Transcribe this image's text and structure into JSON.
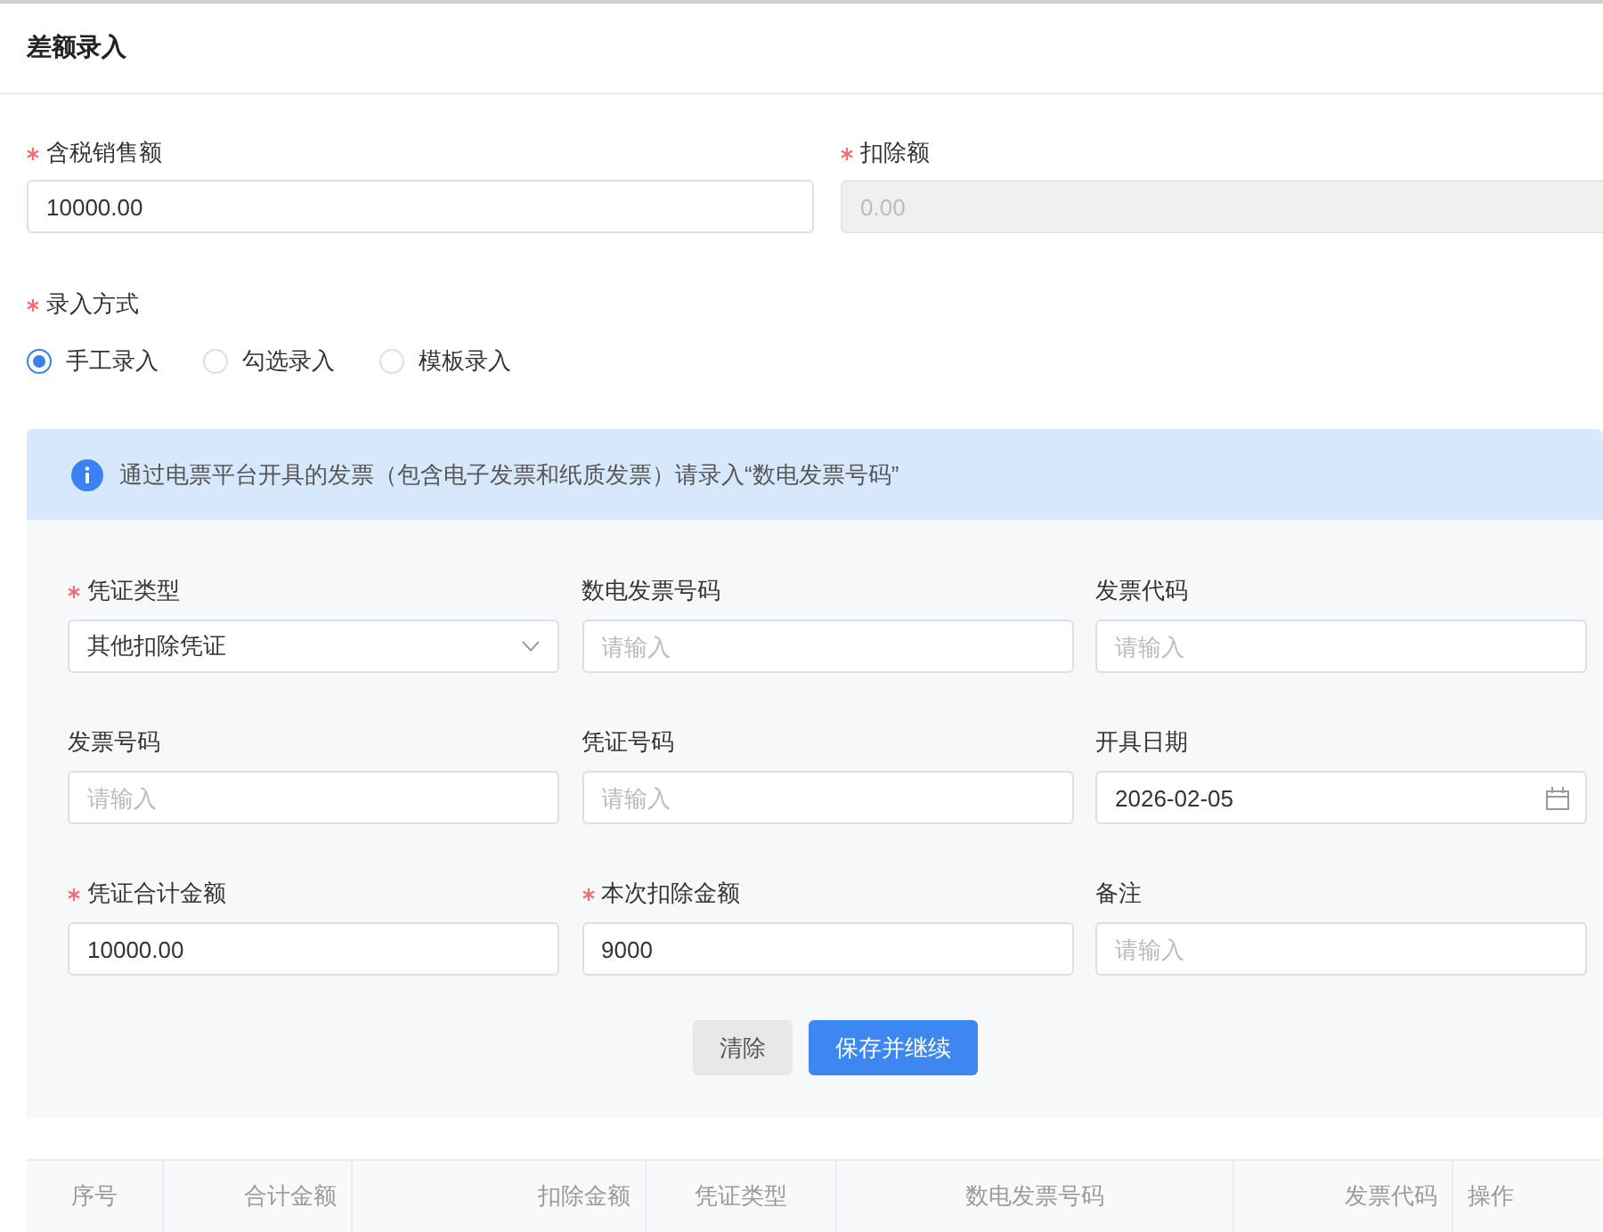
{
  "page": {
    "title": "差额录入"
  },
  "top_fields": [
    {
      "label": "含税销售额",
      "required": true,
      "value": "10000.00",
      "disabled": false
    },
    {
      "label": "扣除额",
      "required": true,
      "value": "0.00",
      "disabled": true
    }
  ],
  "entry_method": {
    "label": "录入方式",
    "required": true,
    "options": [
      {
        "label": "手工录入",
        "selected": true
      },
      {
        "label": "勾选录入",
        "selected": false
      },
      {
        "label": "模板录入",
        "selected": false
      }
    ]
  },
  "notice": {
    "text": "通过电票平台开具的发票（包含电子发票和纸质发票）请录入“数电发票号码”"
  },
  "voucher_form": {
    "fields": [
      {
        "kind": "select",
        "label": "凭证类型",
        "required": true,
        "value": "其他扣除凭证"
      },
      {
        "kind": "text",
        "label": "数电发票号码",
        "required": false,
        "placeholder": "请输入"
      },
      {
        "kind": "text",
        "label": "发票代码",
        "required": false,
        "placeholder": "请输入"
      },
      {
        "kind": "text",
        "label": "发票号码",
        "required": false,
        "placeholder": "请输入"
      },
      {
        "kind": "text",
        "label": "凭证号码",
        "required": false,
        "placeholder": "请输入"
      },
      {
        "kind": "date",
        "label": "开具日期",
        "required": false,
        "value": "2026-02-05"
      },
      {
        "kind": "text",
        "label": "凭证合计金额",
        "required": true,
        "value": "10000.00"
      },
      {
        "kind": "text",
        "label": "本次扣除金额",
        "required": true,
        "value": "9000"
      },
      {
        "kind": "text",
        "label": "备注",
        "required": false,
        "placeholder": "请输入"
      }
    ],
    "buttons": [
      {
        "label": "清除",
        "kind": "secondary"
      },
      {
        "label": "保存并继续",
        "kind": "primary"
      }
    ]
  },
  "table": {
    "columns": [
      "序号",
      "合计金额",
      "扣除金额",
      "凭证类型",
      "数电发票号码",
      "发票代码",
      "操作"
    ]
  }
}
